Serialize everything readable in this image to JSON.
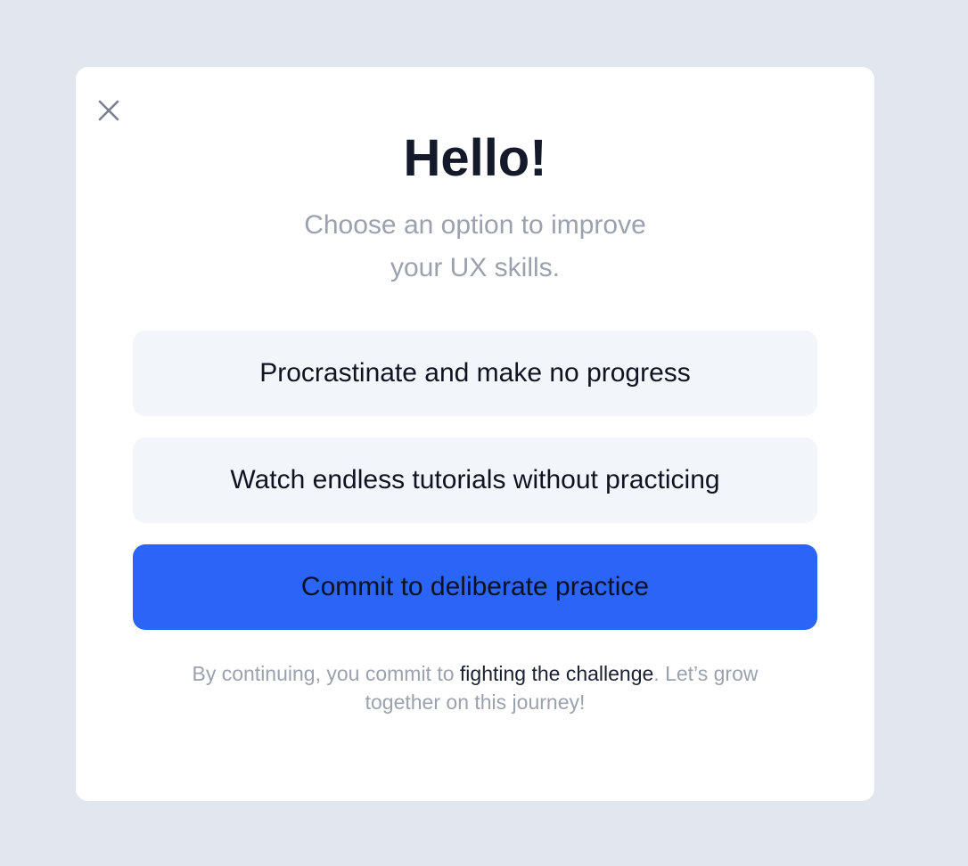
{
  "modal": {
    "close_icon": "close-icon",
    "title": "Hello!",
    "subtitle_line1": "Choose an option to improve",
    "subtitle_line2": "your UX skills.",
    "options": [
      {
        "label": "Procrastinate and make no progress"
      },
      {
        "label": "Watch endless tutorials without practicing"
      },
      {
        "label": "Commit to deliberate practice"
      }
    ],
    "footer": {
      "prefix": "By continuing, you commit to ",
      "highlight": "fighting the challenge",
      "suffix": ". Let’s grow",
      "line2": "together on this journey!"
    }
  },
  "colors": {
    "page_background": "#e2e7ef",
    "modal_background": "#ffffff",
    "primary_button": "#2b65f7",
    "secondary_button": "#f2f5f9",
    "title_text": "#141a29",
    "muted_text": "#9ba1ad"
  }
}
